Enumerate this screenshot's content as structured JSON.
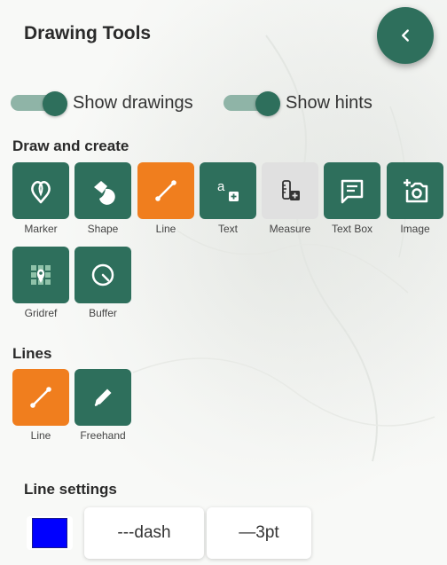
{
  "header": {
    "title": "Drawing Tools",
    "back_icon": "chevron-left-icon"
  },
  "toggles": [
    {
      "label": "Show drawings",
      "on": true
    },
    {
      "label": "Show hints",
      "on": true
    }
  ],
  "draw_section": {
    "title": "Draw and create",
    "tools": [
      {
        "label": "Marker",
        "icon": "marker-icon",
        "state": "normal"
      },
      {
        "label": "Shape",
        "icon": "shape-icon",
        "state": "normal"
      },
      {
        "label": "Line",
        "icon": "line-icon",
        "state": "active"
      },
      {
        "label": "Text",
        "icon": "text-icon",
        "state": "normal"
      },
      {
        "label": "Measure",
        "icon": "measure-icon",
        "state": "disabled"
      },
      {
        "label": "Text Box",
        "icon": "text-box-icon",
        "state": "normal"
      },
      {
        "label": "Image",
        "icon": "add-photo-icon",
        "state": "normal"
      },
      {
        "label": "Gridref",
        "icon": "gridref-icon",
        "state": "normal"
      },
      {
        "label": "Buffer",
        "icon": "buffer-icon",
        "state": "normal"
      }
    ]
  },
  "lines_section": {
    "title": "Lines",
    "tools": [
      {
        "label": "Line",
        "icon": "line-icon",
        "state": "active"
      },
      {
        "label": "Freehand",
        "icon": "pencil-icon",
        "state": "normal"
      }
    ]
  },
  "line_settings": {
    "title": "Line settings",
    "color": "#0000ff",
    "dash_label": "---dash",
    "width_label": "—3pt"
  },
  "colors": {
    "primary": "#2e6f5c",
    "accent": "#f07e1e",
    "disabled": "#e0e0e0"
  }
}
